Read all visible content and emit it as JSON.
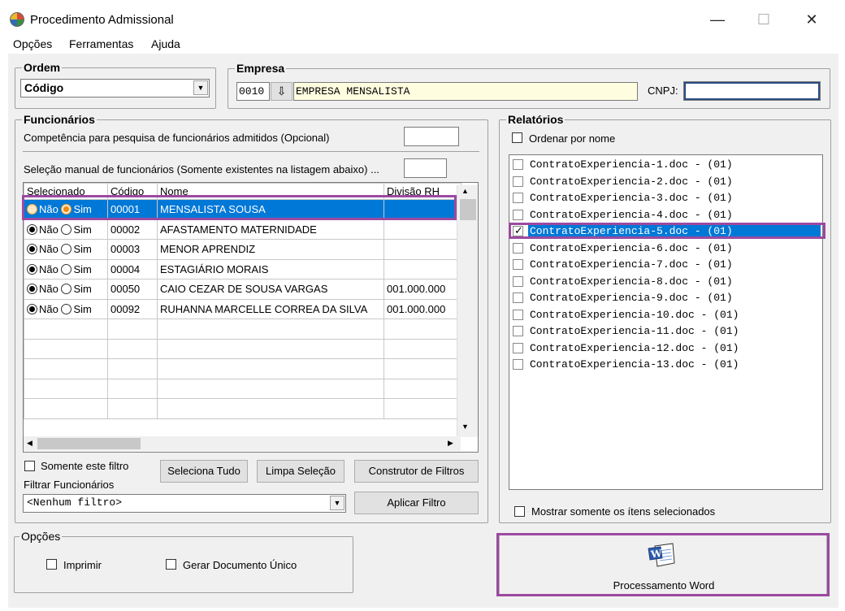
{
  "window": {
    "title": "Procedimento Admissional",
    "minimize": "—",
    "maximize": "☐",
    "close": "✕"
  },
  "menu": [
    "Opções",
    "Ferramentas",
    "Ajuda"
  ],
  "ordem": {
    "title": "Ordem",
    "value": "Código"
  },
  "empresa": {
    "title": "Empresa",
    "code": "0010",
    "name": "EMPRESA MENSALISTA",
    "cnpj_label": "CNPJ:",
    "cnpj_value": ""
  },
  "funcionarios": {
    "title": "Funcionários",
    "competencia_label": "Competência para pesquisa de funcionários admitidos (Opcional)",
    "selecao_label": "Seleção manual de funcionários (Somente existentes na listagem abaixo) ...",
    "columns": [
      "Selecionado",
      "Código",
      "Nome",
      "Divisão RH"
    ],
    "radio_no": "Não",
    "radio_yes": "Sim",
    "rows": [
      {
        "code": "00001",
        "name": "MENSALISTA SOUSA",
        "division": "",
        "selected": "yes"
      },
      {
        "code": "00002",
        "name": "AFASTAMENTO MATERNIDADE",
        "division": "",
        "selected": "no"
      },
      {
        "code": "00003",
        "name": "MENOR APRENDIZ",
        "division": "",
        "selected": "no"
      },
      {
        "code": "00004",
        "name": "ESTAGIÁRIO MORAIS",
        "division": "",
        "selected": "no"
      },
      {
        "code": "00050",
        "name": "CAIO CEZAR DE SOUSA VARGAS",
        "division": "001.000.000",
        "selected": "no"
      },
      {
        "code": "00092",
        "name": "RUHANNA MARCELLE CORREA DA SILVA",
        "division": "001.000.000",
        "selected": "no"
      }
    ],
    "somente_filtro": "Somente este filtro",
    "seleciona_tudo": "Seleciona Tudo",
    "limpa_selecao": "Limpa Seleção",
    "construtor_filtros": "Construtor de Filtros",
    "filtrar_label": "Filtrar Funcionários",
    "filtro_value": "<Nenhum filtro>",
    "aplicar_filtro": "Aplicar Filtro"
  },
  "relatorios": {
    "title": "Relatórios",
    "ordenar_por_nome": "Ordenar por nome",
    "items": [
      {
        "label": "ContratoExperiencia-1.doc - (01)",
        "checked": false
      },
      {
        "label": "ContratoExperiencia-2.doc - (01)",
        "checked": false
      },
      {
        "label": "ContratoExperiencia-3.doc - (01)",
        "checked": false
      },
      {
        "label": "ContratoExperiencia-4.doc - (01)",
        "checked": false
      },
      {
        "label": "ContratoExperiencia-5.doc - (01)",
        "checked": true
      },
      {
        "label": "ContratoExperiencia-6.doc - (01)",
        "checked": false
      },
      {
        "label": "ContratoExperiencia-7.doc - (01)",
        "checked": false
      },
      {
        "label": "ContratoExperiencia-8.doc - (01)",
        "checked": false
      },
      {
        "label": "ContratoExperiencia-9.doc - (01)",
        "checked": false
      },
      {
        "label": "ContratoExperiencia-10.doc - (01)",
        "checked": false
      },
      {
        "label": "ContratoExperiencia-11.doc - (01)",
        "checked": false
      },
      {
        "label": "ContratoExperiencia-12.doc - (01)",
        "checked": false
      },
      {
        "label": "ContratoExperiencia-13.doc - (01)",
        "checked": false
      }
    ],
    "mostrar_selecionados": "Mostrar somente os ítens selecionados"
  },
  "opcoes": {
    "title": "Opções",
    "imprimir": "Imprimir",
    "gerar_unico": "Gerar Documento Único"
  },
  "processamento_word": {
    "label": "Processamento Word",
    "icon": "word-document-icon"
  },
  "colors": {
    "selection": "#0078d7",
    "highlight": "#9b4aa0",
    "empresa_bg": "#fffde0"
  }
}
